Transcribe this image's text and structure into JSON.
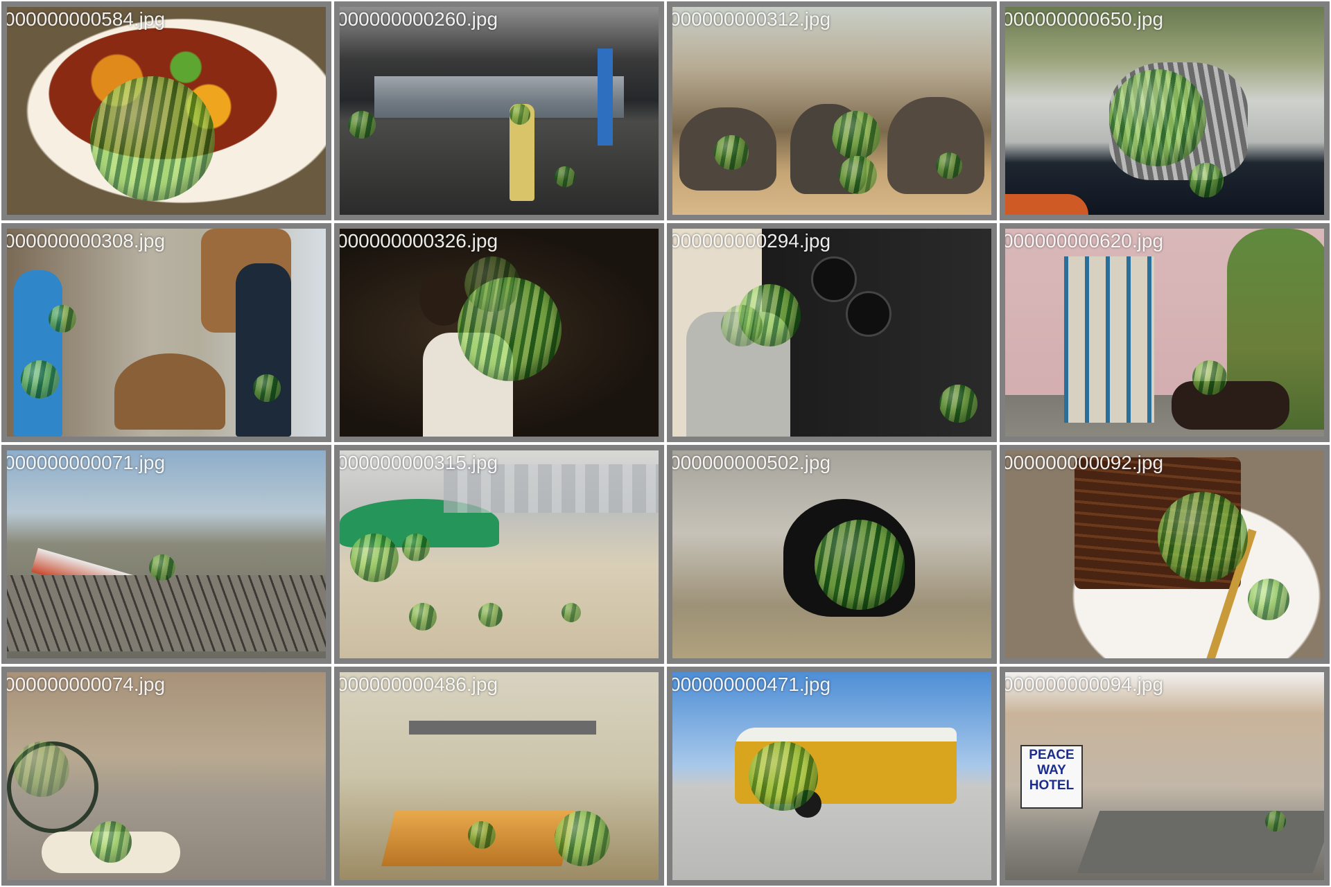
{
  "tiles": [
    {
      "filename": "000000000584.jpg"
    },
    {
      "filename": "000000000260.jpg"
    },
    {
      "filename": "000000000312.jpg"
    },
    {
      "filename": "000000000650.jpg"
    },
    {
      "filename": "000000000308.jpg"
    },
    {
      "filename": "000000000326.jpg"
    },
    {
      "filename": "000000000294.jpg"
    },
    {
      "filename": "000000000620.jpg"
    },
    {
      "filename": "000000000071.jpg"
    },
    {
      "filename": "000000000315.jpg"
    },
    {
      "filename": "000000000502.jpg"
    },
    {
      "filename": "000000000092.jpg"
    },
    {
      "filename": "000000000074.jpg"
    },
    {
      "filename": "000000000486.jpg"
    },
    {
      "filename": "000000000471.jpg"
    },
    {
      "filename": "000000000094.jpg"
    }
  ],
  "signage": {
    "hotel_sign": "PEACE WAY HOTEL"
  },
  "colors": {
    "tile_border": "#7f7f7f",
    "filename_text": "#ffffff",
    "watermelon_dark": "#1f6b1a",
    "watermelon_light": "#a6dd66"
  }
}
